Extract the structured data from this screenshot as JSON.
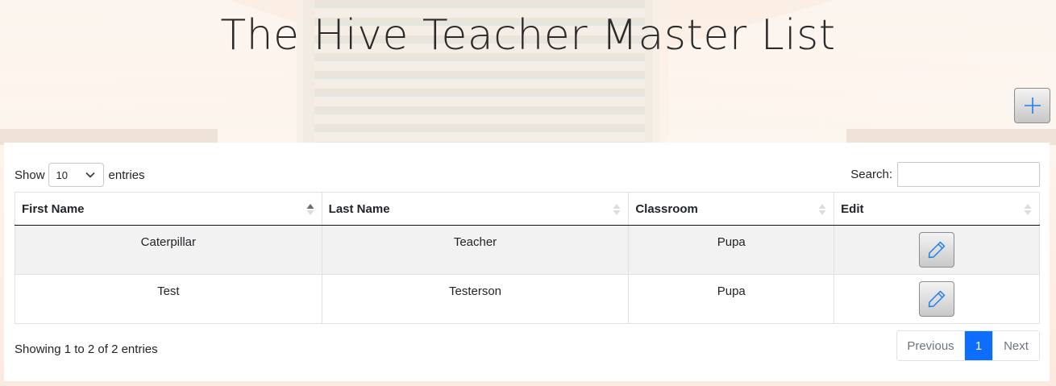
{
  "page": {
    "title": "The Hive Teacher Master List",
    "add_icon": "plus-icon"
  },
  "table_controls": {
    "show_label": "Show",
    "page_length": "10",
    "entries_label": "entries",
    "search_label": "Search:",
    "search_value": ""
  },
  "table": {
    "columns": [
      "First Name",
      "Last Name",
      "Classroom",
      "Edit"
    ],
    "sorted_column": "First Name",
    "sort_direction": "ascending",
    "rows": [
      {
        "first_name": "Caterpillar",
        "last_name": "Teacher",
        "classroom": "Pupa",
        "edit_icon": "pencil-icon"
      },
      {
        "first_name": "Test",
        "last_name": "Testerson",
        "classroom": "Pupa",
        "edit_icon": "pencil-icon"
      }
    ]
  },
  "footer": {
    "info": "Showing 1 to 2 of 2 entries",
    "pagination": {
      "previous": "Previous",
      "current": "1",
      "next": "Next"
    }
  },
  "colors": {
    "accent": "#0d6efd",
    "icon_blue": "#1e7ef0",
    "striped_row": "#f2f2f2"
  }
}
